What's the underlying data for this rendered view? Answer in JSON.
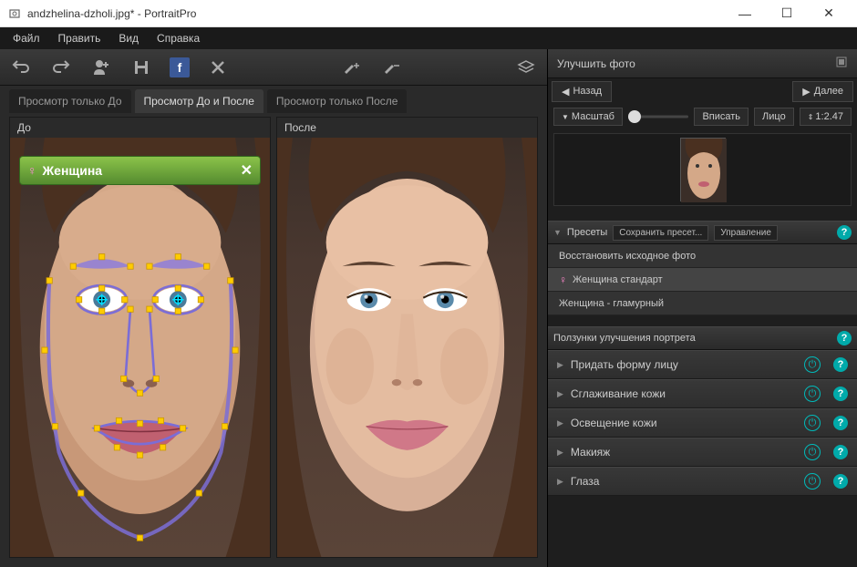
{
  "window": {
    "title": "andzhelina-dzholi.jpg* - PortraitPro"
  },
  "menu": {
    "file": "Файл",
    "edit": "Править",
    "view": "Вид",
    "help": "Справка"
  },
  "view_tabs": {
    "before_only": "Просмотр только До",
    "before_after": "Просмотр До и После",
    "after_only": "Просмотр только После"
  },
  "panes": {
    "before": "До",
    "after": "После"
  },
  "gender_tag": {
    "label": "Женщина",
    "close": "✕"
  },
  "right": {
    "header": "Улучшить фото",
    "back": "Назад",
    "next": "Далее",
    "zoom_label": "Масштаб",
    "fit": "Вписать",
    "face": "Лицо",
    "zoom_value": "1:2.47"
  },
  "presets": {
    "header": "Пресеты",
    "save": "Сохранить пресет...",
    "manage": "Управление",
    "items": [
      {
        "label": "Восстановить исходное фото",
        "gender": false
      },
      {
        "label": "Женщина стандарт",
        "gender": true
      },
      {
        "label": "Женщина - гламурный",
        "gender": false
      }
    ]
  },
  "sliders": {
    "header": "Ползунки улучшения портрета",
    "items": [
      "Придать форму лицу",
      "Сглаживание кожи",
      "Освещение кожи",
      "Макияж",
      "Глаза"
    ]
  }
}
